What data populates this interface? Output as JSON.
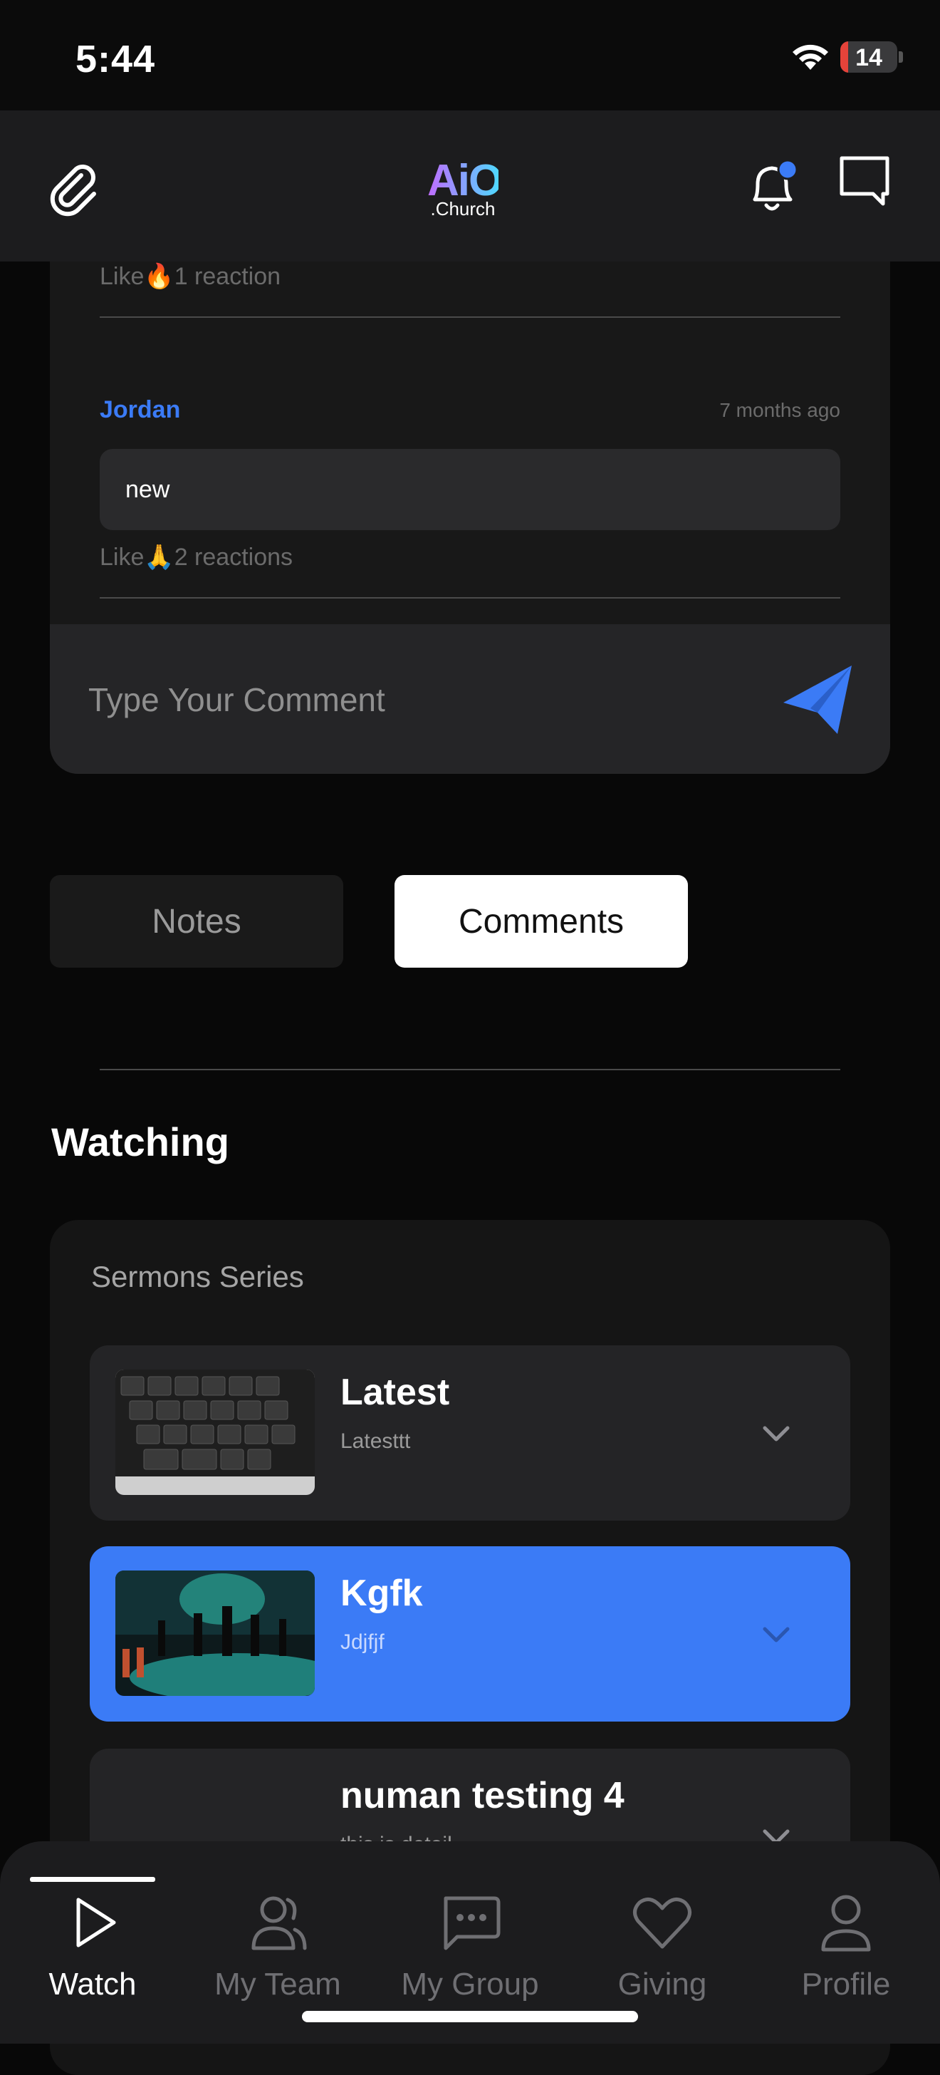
{
  "status_bar": {
    "time": "5:44",
    "battery_level": "14",
    "battery_fill": 0.14
  },
  "header": {
    "logo_main": "AiO",
    "logo_sub": ".Church"
  },
  "comments": {
    "items": [
      {
        "author": "",
        "time_ago": "",
        "text": "",
        "reactions": "Like🔥1 reaction"
      },
      {
        "author": "Jordan",
        "time_ago": "7 months ago",
        "text": "new",
        "reactions": "Like🙏2 reactions"
      }
    ],
    "input_placeholder": "Type Your Comment"
  },
  "tabs": {
    "notes_label": "Notes",
    "comments_label": "Comments",
    "active": "Comments"
  },
  "watching": {
    "title": "Watching",
    "series_label": "Sermons Series",
    "items": [
      {
        "title": "Latest",
        "subtitle": "Latesttt",
        "thumbnail": "keyboard-photo"
      },
      {
        "title": "Kgfk",
        "subtitle": "Jdjfjf",
        "thumbnail": "concert-stage-photo",
        "selected": true
      },
      {
        "title": "numan testing 4",
        "subtitle": "this is detail",
        "thumbnail": ""
      }
    ]
  },
  "bottom_nav": {
    "items": [
      {
        "label": "Watch",
        "icon": "play-icon",
        "active": true
      },
      {
        "label": "My Team",
        "icon": "team-icon"
      },
      {
        "label": "My Group",
        "icon": "chat-bubble-icon"
      },
      {
        "label": "Giving",
        "icon": "heart-icon"
      },
      {
        "label": "Profile",
        "icon": "profile-icon"
      }
    ]
  },
  "colors": {
    "accent": "#3b7bf6",
    "background": "#080808",
    "card": "#181818"
  }
}
